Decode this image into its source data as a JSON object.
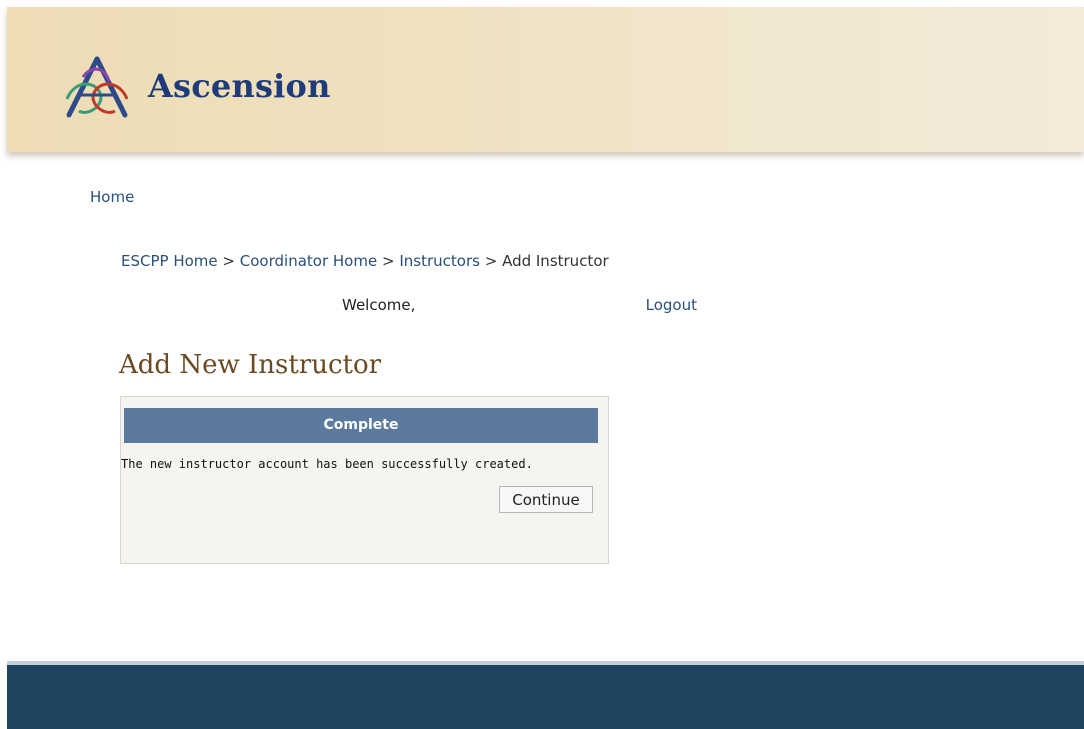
{
  "header": {
    "brand_name": "Ascension"
  },
  "nav": {
    "home_label": "Home"
  },
  "breadcrumb": {
    "items": [
      "ESCPP Home",
      "Coordinator Home",
      "Instructors"
    ],
    "separator": ">",
    "current": "Add Instructor"
  },
  "user_bar": {
    "welcome_label": "Welcome,",
    "logout_label": "Logout"
  },
  "page": {
    "title": "Add New Instructor"
  },
  "panel": {
    "status_title": "Complete",
    "message": "The new instructor account has been successfully created.",
    "continue_label": "Continue"
  },
  "colors": {
    "brand_text": "#1f3b7a",
    "title_text": "#6b4a22",
    "panel_header": "#5b7a9d",
    "footer": "#1e4460",
    "link": "#294f7a"
  }
}
